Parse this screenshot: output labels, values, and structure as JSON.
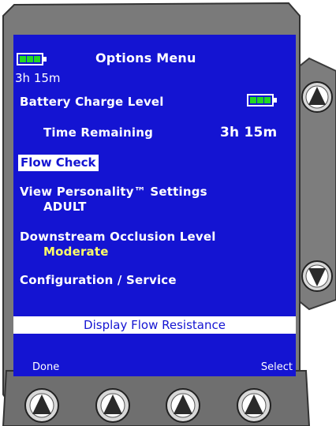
{
  "header": {
    "title": "Options Menu",
    "battery_time": "3h 15m"
  },
  "menu": {
    "battery_charge_label": "Battery Charge Level",
    "time_remaining_label": "Time Remaining",
    "time_remaining_value": "3h 15m",
    "flow_check_label": "Flow Check",
    "personality_label": "View Personality™ Settings",
    "personality_value": "ADULT",
    "occlusion_label": "Downstream Occlusion Level",
    "occlusion_value": "Moderate",
    "config_label": "Configuration / Service"
  },
  "selected_item": "Display Flow Resistance",
  "softkeys": {
    "left": "Done",
    "right": "Select"
  },
  "colors": {
    "screen_bg": "#1414d2",
    "battery_fill": "#22d822",
    "highlight_value": "#ffff66",
    "device_body": "#7a7a7a"
  },
  "icons": [
    "battery-icon",
    "up-arrow-icon",
    "down-arrow-icon",
    "softkey-arrow-icon"
  ]
}
